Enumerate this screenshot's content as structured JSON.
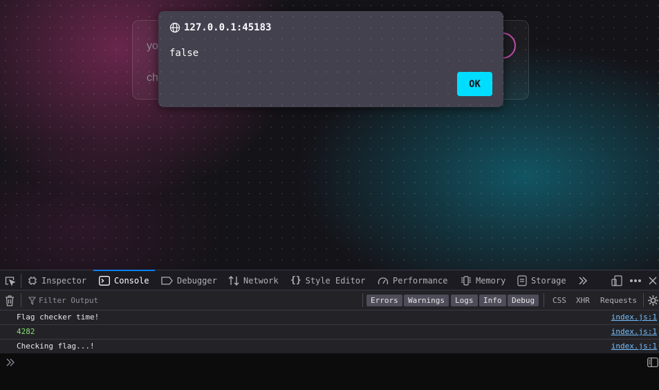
{
  "page": {
    "card_line_1": "yo",
    "card_line_2": "ch"
  },
  "dialog": {
    "origin": "127.0.0.1:45183",
    "message": "false",
    "ok_label": "OK"
  },
  "devtools": {
    "tabs": [
      {
        "label": "Inspector",
        "icon": "inspector-icon"
      },
      {
        "label": "Console",
        "icon": "console-icon",
        "active": true
      },
      {
        "label": "Debugger",
        "icon": "debugger-icon"
      },
      {
        "label": "Network",
        "icon": "network-icon"
      },
      {
        "label": "Style Editor",
        "icon": "style-editor-icon"
      },
      {
        "label": "Performance",
        "icon": "performance-icon"
      },
      {
        "label": "Memory",
        "icon": "memory-icon"
      },
      {
        "label": "Storage",
        "icon": "storage-icon"
      }
    ],
    "filter": {
      "placeholder": "Filter Output",
      "levels": [
        "Errors",
        "Warnings",
        "Logs",
        "Info",
        "Debug"
      ],
      "categories": [
        "CSS",
        "XHR",
        "Requests"
      ]
    },
    "logs": [
      {
        "message": "Flag checker time!",
        "source": "index.js:1"
      },
      {
        "message": "4282",
        "source": "index.js:1"
      },
      {
        "message": "Checking flag...!",
        "source": "index.js:1"
      }
    ]
  },
  "colors": {
    "accent": "#00ddff",
    "active_tab": "#0a84ff",
    "number_log": "#86de74",
    "link": "#75bfff"
  }
}
